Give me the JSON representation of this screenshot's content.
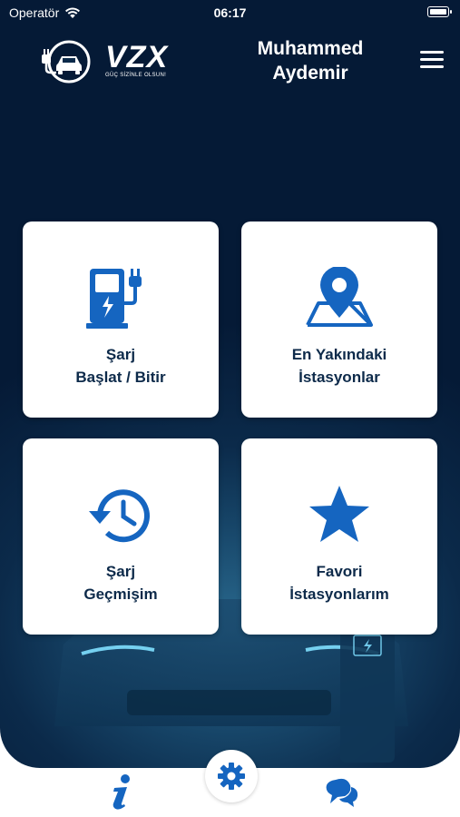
{
  "status_bar": {
    "carrier": "Operatör",
    "time": "06:17"
  },
  "header": {
    "logo": {
      "brand": "VZX",
      "slogan": "GÜÇ SİZİNLE OLSUN!"
    },
    "user_name": "Muhammed\nAydemir",
    "menu_icon": "hamburger-menu-icon"
  },
  "tiles": [
    {
      "label": "Şarj\nBaşlat / Bitir",
      "icon": "charging-station-icon"
    },
    {
      "label": "En Yakındaki\nİstasyonlar",
      "icon": "map-pin-icon"
    },
    {
      "label": "Şarj\nGeçmişim",
      "icon": "history-clock-icon"
    },
    {
      "label": "Favori\nİstasyonlarım",
      "icon": "star-icon"
    }
  ],
  "bottom_bar": {
    "left": "info-icon",
    "center": "gear-icon",
    "right": "chat-bubbles-icon"
  },
  "colors": {
    "background": "#0b2a4a",
    "accent": "#1565c0",
    "tile_text": "#0d2a4a",
    "tile_background": "#ffffff"
  }
}
